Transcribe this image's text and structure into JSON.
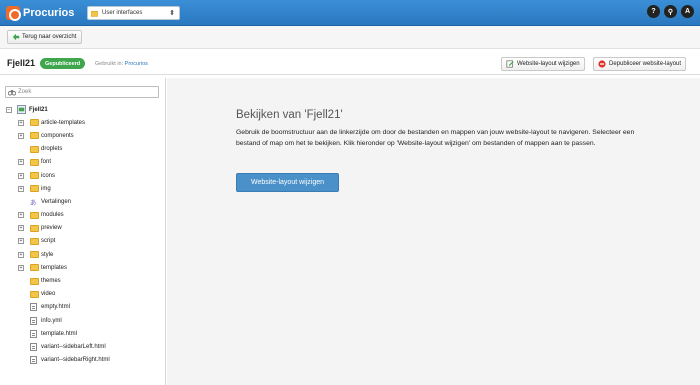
{
  "app": {
    "name": "Procurios"
  },
  "context_select": {
    "value": "User interfaces"
  },
  "top_icons": {
    "help": "?",
    "search": "⚲",
    "avatar": "A"
  },
  "back_button": {
    "label": "Terug naar overzicht"
  },
  "site": {
    "title": "Fjell21",
    "status": "Gepubliceerd",
    "used_in_label": "Gebruikt in:",
    "used_in_value": "Procurios",
    "edit_button": "Website-layout wijzigen",
    "unpublish_button": "Depubliceer website-layout"
  },
  "sidebar": {
    "search_placeholder": "Zoek",
    "root": "Fjell21",
    "items": [
      {
        "label": "article-templates",
        "type": "folder",
        "expandable": true
      },
      {
        "label": "components",
        "type": "folder",
        "expandable": true
      },
      {
        "label": "droplets",
        "type": "folder",
        "expandable": false
      },
      {
        "label": "font",
        "type": "folder",
        "expandable": true
      },
      {
        "label": "icons",
        "type": "folder",
        "expandable": true
      },
      {
        "label": "img",
        "type": "folder",
        "expandable": true
      },
      {
        "label": "Vertalingen",
        "type": "translations",
        "expandable": false
      },
      {
        "label": "modules",
        "type": "folder",
        "expandable": true
      },
      {
        "label": "preview",
        "type": "folder",
        "expandable": true
      },
      {
        "label": "script",
        "type": "folder",
        "expandable": true
      },
      {
        "label": "style",
        "type": "folder",
        "expandable": true
      },
      {
        "label": "templates",
        "type": "folder",
        "expandable": true
      },
      {
        "label": "themes",
        "type": "folder",
        "expandable": false
      },
      {
        "label": "video",
        "type": "folder",
        "expandable": false
      },
      {
        "label": "empty.html",
        "type": "file",
        "expandable": false
      },
      {
        "label": "info.yml",
        "type": "file",
        "expandable": false
      },
      {
        "label": "template.html",
        "type": "file",
        "expandable": false
      },
      {
        "label": "variant--sidebarLeft.html",
        "type": "file",
        "expandable": false
      },
      {
        "label": "variant--sidebarRight.html",
        "type": "file",
        "expandable": false
      }
    ]
  },
  "main": {
    "title": "Bekijken van 'Fjell21'",
    "description": "Gebruik de boomstructuur aan de linkerzijde om door de bestanden en mappen van jouw website-layout te navigeren. Selecteer een bestand of map om het te bekijken. Klik hieronder op 'Website-layout wijzigen' om bestanden of mappen aan te passen.",
    "button": "Website-layout wijzigen"
  },
  "colors": {
    "topbar": "#2a78c0",
    "status": "#3fa64e",
    "primary": "#4a90c9",
    "folder": "#f3c548"
  }
}
